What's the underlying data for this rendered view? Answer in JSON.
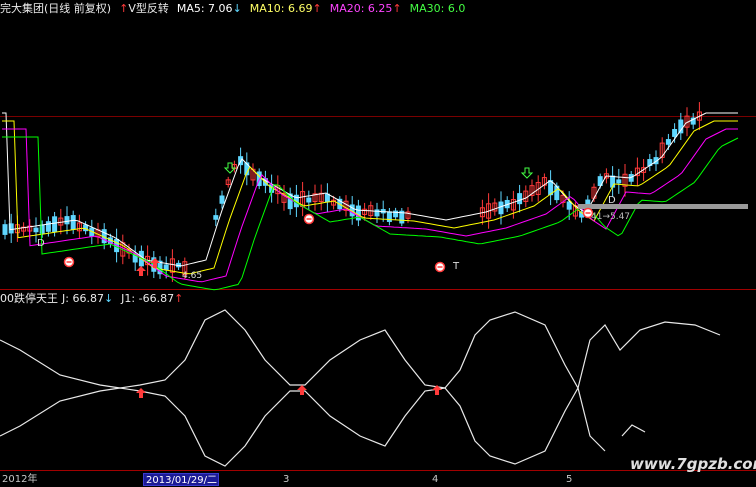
{
  "upper_panel": {
    "title": "完大集团(日线 前复权)",
    "indicator_arrow": "↑",
    "indicator_name": "V型反转",
    "ma5": "MA5: 7.06",
    "ma5_arrow": "↓",
    "ma10": "MA10: 6.69",
    "ma10_arrow": "↑",
    "ma20": "MA20: 6.25",
    "ma20_arrow": "↑",
    "ma30": "MA30: 6.0",
    "marker_d1": "D",
    "marker_d2": "D",
    "marker_t": "T",
    "low_label": "4.65",
    "price_label": "41→5.47"
  },
  "lower_panel": {
    "name": "00跌停天王",
    "j": "J: 66.87",
    "j_arrow": "↓",
    "j1": "J1: -66.87",
    "j1_arrow": "↑"
  },
  "x_axis": {
    "year_label": "2012年",
    "date_label": "2013/01/29/二",
    "tick_3": "3",
    "tick_4": "4",
    "tick_5": "5"
  },
  "watermark": "www.7gpzb.com",
  "colors": {
    "background": "#000000",
    "up": "#ff3a3a",
    "down": "#5fd7ff",
    "ma5": "#ffffff",
    "ma10": "#ffff00",
    "ma20": "#ff00ff",
    "ma30": "#00ff00",
    "divider": "#7a0000"
  }
}
